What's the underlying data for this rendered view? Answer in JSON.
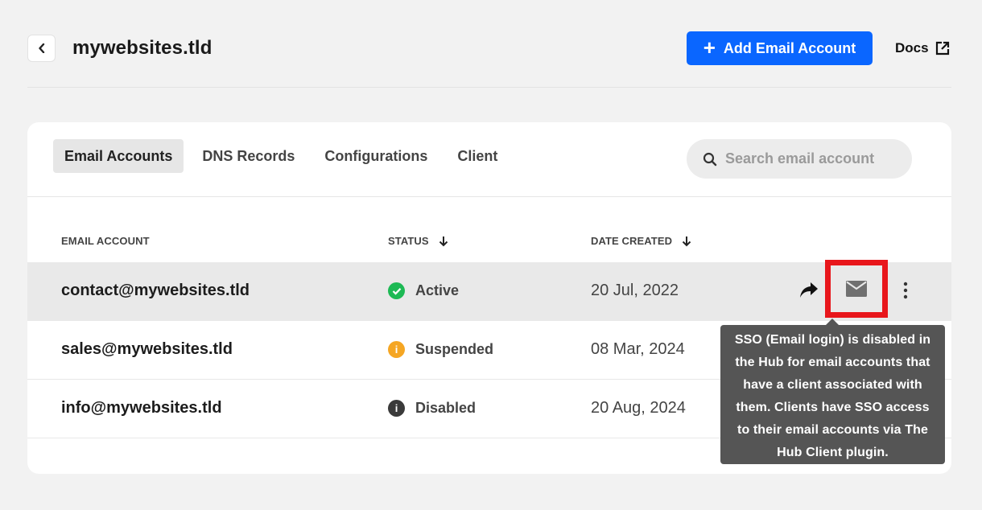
{
  "header": {
    "title": "mywebsites.tld",
    "add_button_label": "Add Email Account",
    "docs_label": "Docs"
  },
  "tabs": [
    {
      "label": "Email Accounts",
      "active": true
    },
    {
      "label": "DNS Records",
      "active": false
    },
    {
      "label": "Configurations",
      "active": false
    },
    {
      "label": "Client",
      "active": false
    }
  ],
  "search": {
    "placeholder": "Search email account",
    "value": ""
  },
  "table": {
    "columns": [
      "EMAIL ACCOUNT",
      "STATUS",
      "DATE CREATED"
    ],
    "rows": [
      {
        "email": "contact@mywebsites.tld",
        "status": "Active",
        "status_icon": "check-circle-icon",
        "status_color": "#1db954",
        "date": "20 Jul, 2022"
      },
      {
        "email": "sales@mywebsites.tld",
        "status": "Suspended",
        "status_icon": "info-circle-icon",
        "status_color": "#f5a623",
        "date": "08 Mar, 2024"
      },
      {
        "email": "info@mywebsites.tld",
        "status": "Disabled",
        "status_icon": "info-circle-icon",
        "status_color": "#3a3a3a",
        "date": "20 Aug, 2024"
      }
    ]
  },
  "tooltip": {
    "text": "SSO (Email login) is disabled in the Hub for email accounts that have a client associated with them. Clients have SSO access to their email accounts via The Hub Client plugin."
  },
  "colors": {
    "accent": "#0a66ff",
    "highlight_border": "#e8161b",
    "tooltip_bg": "#555555"
  }
}
